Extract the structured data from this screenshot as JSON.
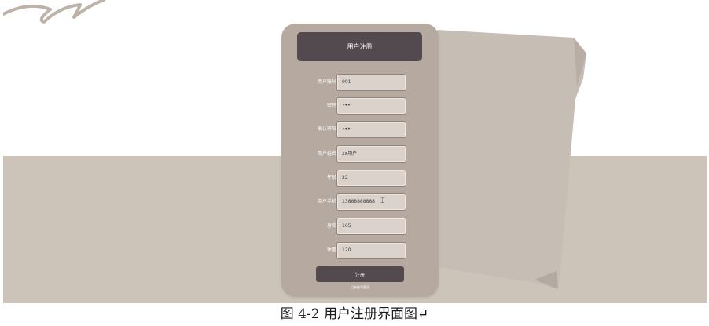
{
  "form": {
    "title": "用户注册",
    "fields": [
      {
        "label": "用户账号:",
        "value": "001"
      },
      {
        "label": "密码:",
        "value": "•••"
      },
      {
        "label": "确认密码:",
        "value": "•••"
      },
      {
        "label": "用户姓名:",
        "value": "xx用户"
      },
      {
        "label": "年龄:",
        "value": "22"
      },
      {
        "label": "用户手机:",
        "value": "13888888888"
      },
      {
        "label": "身高:",
        "value": "165"
      },
      {
        "label": "体重:",
        "value": "120"
      }
    ],
    "submit_label": "注册",
    "login_link": "已有账号登录"
  },
  "caption": "图 4-2 用户注册界面图↵",
  "colors": {
    "card": "#b6aaa0",
    "header": "#524a4f",
    "floor": "#cdc4b9",
    "input": "#dcd2cc"
  }
}
